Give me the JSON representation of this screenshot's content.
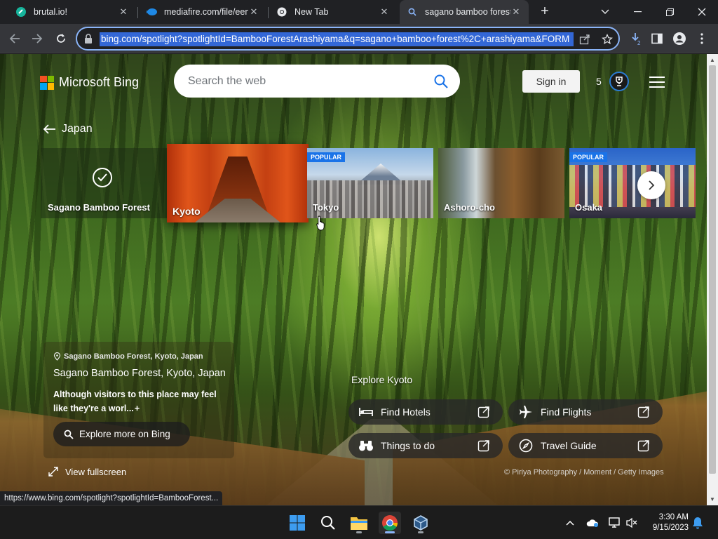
{
  "tabs": [
    {
      "title": "brutal.io!",
      "favicon": "link-icon",
      "active": false
    },
    {
      "title": "mediafire.com/file/eemt",
      "favicon": "mediafire-icon",
      "active": false
    },
    {
      "title": "New Tab",
      "favicon": "chrome-icon",
      "active": false
    },
    {
      "title": "sagano bamboo forest",
      "favicon": "bing-search-icon",
      "active": true
    }
  ],
  "address_bar": {
    "url": "bing.com/spotlight?spotlightId=BambooForestArashiyama&q=sagano+bamboo+forest%2C+arashiyama&FORM"
  },
  "bing": {
    "logo_text": "Microsoft Bing",
    "search_placeholder": "Search the web",
    "sign_in": "Sign in",
    "rewards_count": "5",
    "back_label": "Japan",
    "carousel": [
      {
        "label": "Sagano Bamboo Forest",
        "selected": true,
        "popular": false
      },
      {
        "label": "Kyoto",
        "selected": false,
        "popular": false
      },
      {
        "label": "Tokyo",
        "selected": false,
        "popular": true
      },
      {
        "label": "Ashoro-cho",
        "selected": false,
        "popular": false
      },
      {
        "label": "Osaka",
        "selected": false,
        "popular": true
      }
    ],
    "popular_badge": "POPULAR",
    "info": {
      "location_small": "Sagano Bamboo Forest, Kyoto, Japan",
      "title": "Sagano Bamboo Forest, Kyoto, Japan",
      "description": "Although visitors to this place may feel like they're a worl...",
      "more_symbol": "+",
      "explore_button": "Explore more on Bing"
    },
    "view_fullscreen": "View fullscreen",
    "explore_heading": "Explore Kyoto",
    "actions": [
      {
        "label": "Find Hotels",
        "icon": "bed-icon"
      },
      {
        "label": "Find Flights",
        "icon": "airplane-icon"
      },
      {
        "label": "Things to do",
        "icon": "binoculars-icon"
      },
      {
        "label": "Travel Guide",
        "icon": "compass-icon"
      }
    ],
    "credit": "© Piriya Photography / Moment / Getty Images"
  },
  "status_url": "https://www.bing.com/spotlight?spotlightId=BambooForest...",
  "taskbar": {
    "time": "3:30 AM",
    "date": "9/15/2023"
  },
  "colors": {
    "accent_blue": "#1a73e8",
    "omnibox_focus": "#8ab4f8",
    "ms_red": "#f25022",
    "ms_green": "#7fba00",
    "ms_blue": "#00a4ef",
    "ms_yellow": "#ffb900"
  }
}
